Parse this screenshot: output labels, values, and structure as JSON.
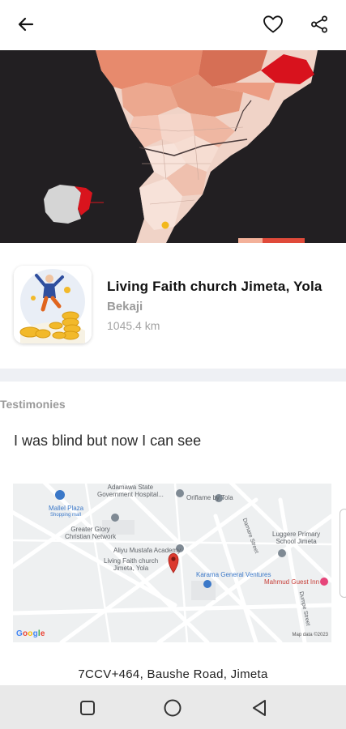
{
  "header": {
    "back_icon": "arrow-left-icon",
    "favorite_icon": "heart-outline-icon",
    "share_icon": "share-icon"
  },
  "hero": {
    "description_icon": "choropleth-map-image"
  },
  "place": {
    "name": "Living Faith church Jimeta, Yola",
    "area": "Bekaji",
    "distance": "1045.4 km",
    "thumbnail_icon": "celebration-coins-illustration"
  },
  "testimonies": {
    "label": "Testimonies",
    "text": "I was blind but now I can see"
  },
  "map": {
    "labels": {
      "hospital": "Adamawa State\nGovernment Hospital...",
      "oriflame": "Oriflame by Tola",
      "plaza": "Mallel Plaza",
      "plaza_sub": "Shopping mall",
      "glory": "Greater Glory\nChristian Network",
      "academy": "Aliyu Mustafa Academy",
      "church": "Living Faith church\nJimeta, Yola",
      "luggere": "Luggere Primary\nSchool Jimeta",
      "karama": "Karama General Ventures",
      "guest": "Mahmud Guest Inn",
      "street1": "Damare Street",
      "street2": "Dumpe Street",
      "google": "Google",
      "credit": "Map data ©2023"
    }
  },
  "address": "7CCV+464, Baushe Road, Jimeta",
  "system_nav": {
    "recents_icon": "square-icon",
    "home_icon": "circle-icon",
    "back_icon": "triangle-back-icon"
  }
}
